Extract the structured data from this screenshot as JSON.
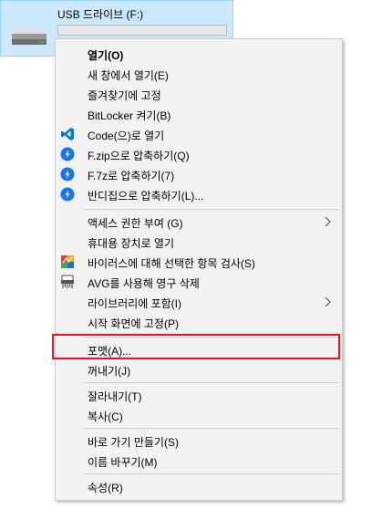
{
  "drive": {
    "name": "USB 드라이브 (F:)",
    "usage_fraction": 0.0,
    "icon": "usb-drive-icon"
  },
  "menu": {
    "items": [
      {
        "label": "열기(O)",
        "icon": ""
      },
      {
        "label": "새 창에서 열기(E)",
        "icon": ""
      },
      {
        "label": "즐겨찾기에 고정",
        "icon": ""
      },
      {
        "label": "BitLocker 켜기(B)",
        "icon": ""
      },
      {
        "label": "Code(으)로 열기",
        "icon": "vscode-icon"
      },
      {
        "label": "F.zip으로 압축하기(Q)",
        "icon": "bandizip-icon"
      },
      {
        "label": "F.7z로 압축하기(7)",
        "icon": "bandizip-icon"
      },
      {
        "label": "반디집으로 압축하기(L)...",
        "icon": "bandizip-icon"
      },
      {
        "label": "액세스 권한 부여 (G)",
        "icon": "",
        "submenu": true
      },
      {
        "label": "휴대용 장치로 열기",
        "icon": ""
      },
      {
        "label": "바이러스에 대해 선택한 항목 검사(S)",
        "icon": "avg-scan-icon"
      },
      {
        "label": "AVG를 사용해 영구 삭제",
        "icon": "shredder-icon"
      },
      {
        "label": "라이브러리에 포함(I)",
        "icon": "",
        "submenu": true
      },
      {
        "label": "시작 화면에 고정(P)",
        "icon": ""
      },
      {
        "label": "포맷(A)...",
        "icon": ""
      },
      {
        "label": "꺼내기(J)",
        "icon": ""
      },
      {
        "label": "잘라내기(T)",
        "icon": ""
      },
      {
        "label": "복사(C)",
        "icon": ""
      },
      {
        "label": "바로 가기 만들기(S)",
        "icon": ""
      },
      {
        "label": "이름 바꾸기(M)",
        "icon": ""
      },
      {
        "label": "속성(R)",
        "icon": ""
      }
    ]
  },
  "colors": {
    "selection_bg": "#cce8ff",
    "menu_bg": "#f2f2f2",
    "highlight_border": "#e3141b",
    "vscode_blue": "#0078d4",
    "bandizip_blue": "#1a73e8"
  }
}
